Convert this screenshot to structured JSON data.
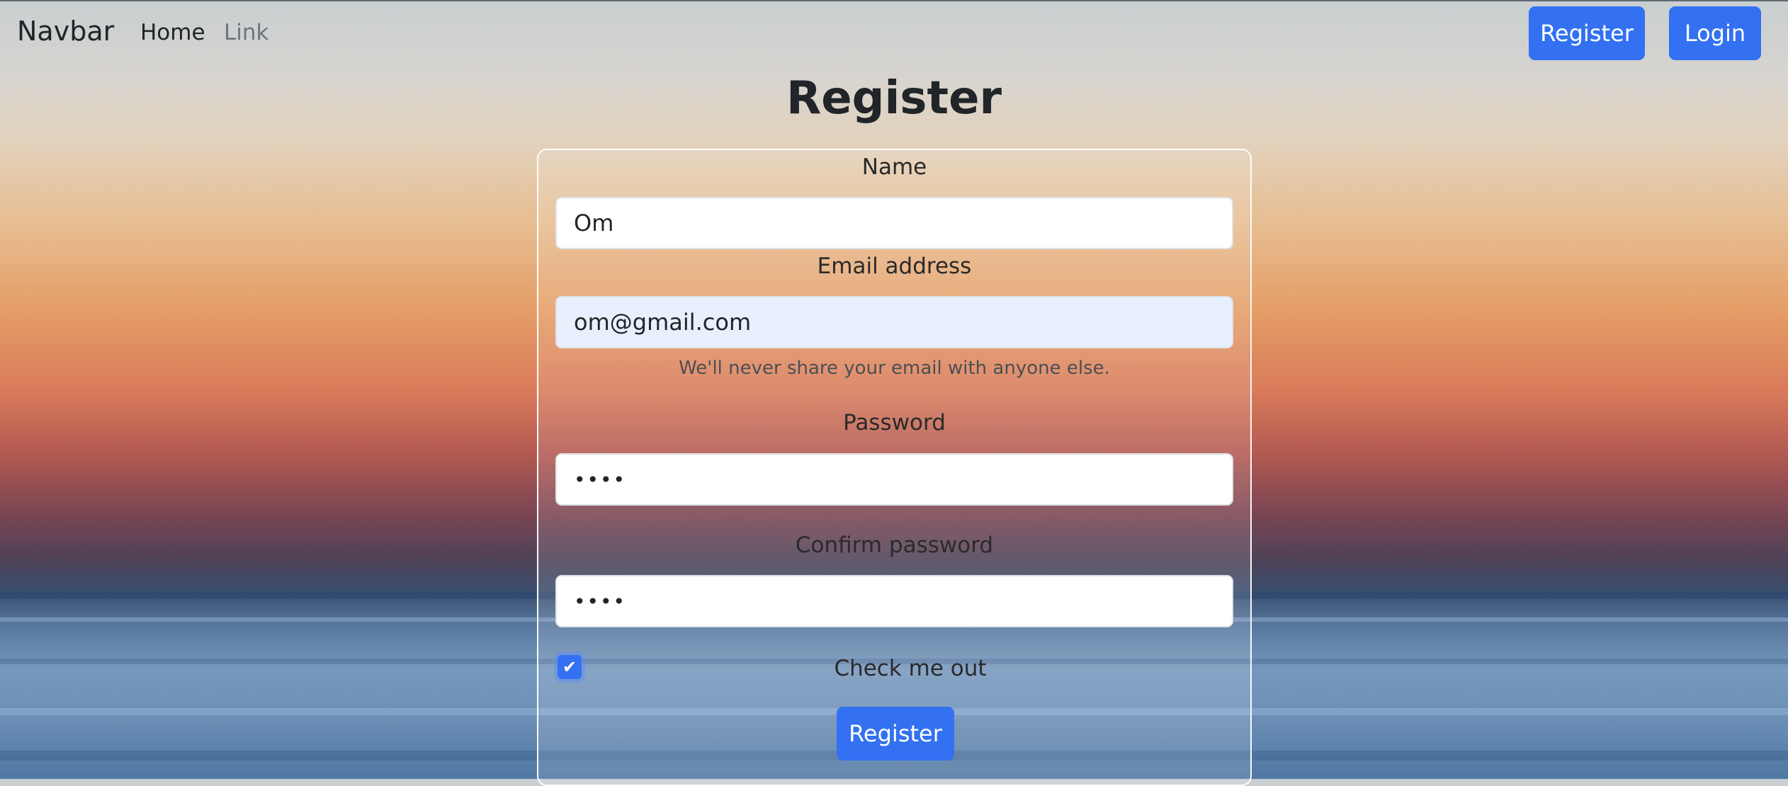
{
  "navbar": {
    "brand": "Navbar",
    "links": [
      {
        "label": "Home",
        "active": true
      },
      {
        "label": "Link",
        "active": false
      }
    ],
    "register_label": "Register",
    "login_label": "Login"
  },
  "page": {
    "title": "Register"
  },
  "form": {
    "name": {
      "label": "Name",
      "value": "Om"
    },
    "email": {
      "label": "Email address",
      "value": "om@gmail.com",
      "help": "We'll never share your email with anyone else."
    },
    "password": {
      "label": "Password",
      "masked_value": "••••"
    },
    "confirm_password": {
      "label": "Confirm password",
      "masked_value": "••••"
    },
    "checkbox": {
      "label": "Check me out",
      "checked": true
    },
    "submit_label": "Register"
  },
  "colors": {
    "primary": "#3371f2",
    "autofill_bg": "#e8f0fe"
  }
}
